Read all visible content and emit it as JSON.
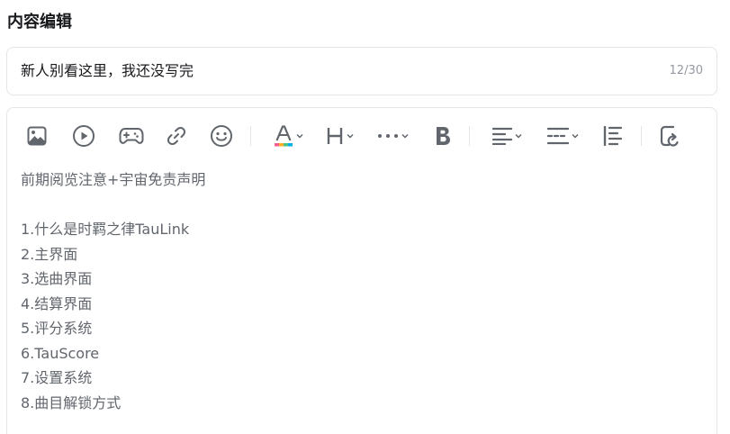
{
  "section": {
    "title": "内容编辑"
  },
  "title_field": {
    "value": "新人别看这里，我还没写完",
    "counter": "12/30"
  },
  "toolbar": {
    "icons": [
      "image-icon",
      "video-icon",
      "gamepad-icon",
      "link-icon",
      "emoji-icon",
      "text-color-icon",
      "heading-icon",
      "more-icon",
      "bold-icon",
      "align-left-icon",
      "line-spacing-icon",
      "indent-icon",
      "undo-icon"
    ]
  },
  "editor": {
    "heading_line": "前期阅览注意+宇宙免责声明",
    "lines": [
      "1.什么是时羁之律TauLink",
      "2.主界面",
      "3.选曲界面",
      "4.结算界面",
      "5.评分系统",
      "6.TauScore",
      "7.设置系统",
      "8.曲目解锁方式"
    ]
  }
}
